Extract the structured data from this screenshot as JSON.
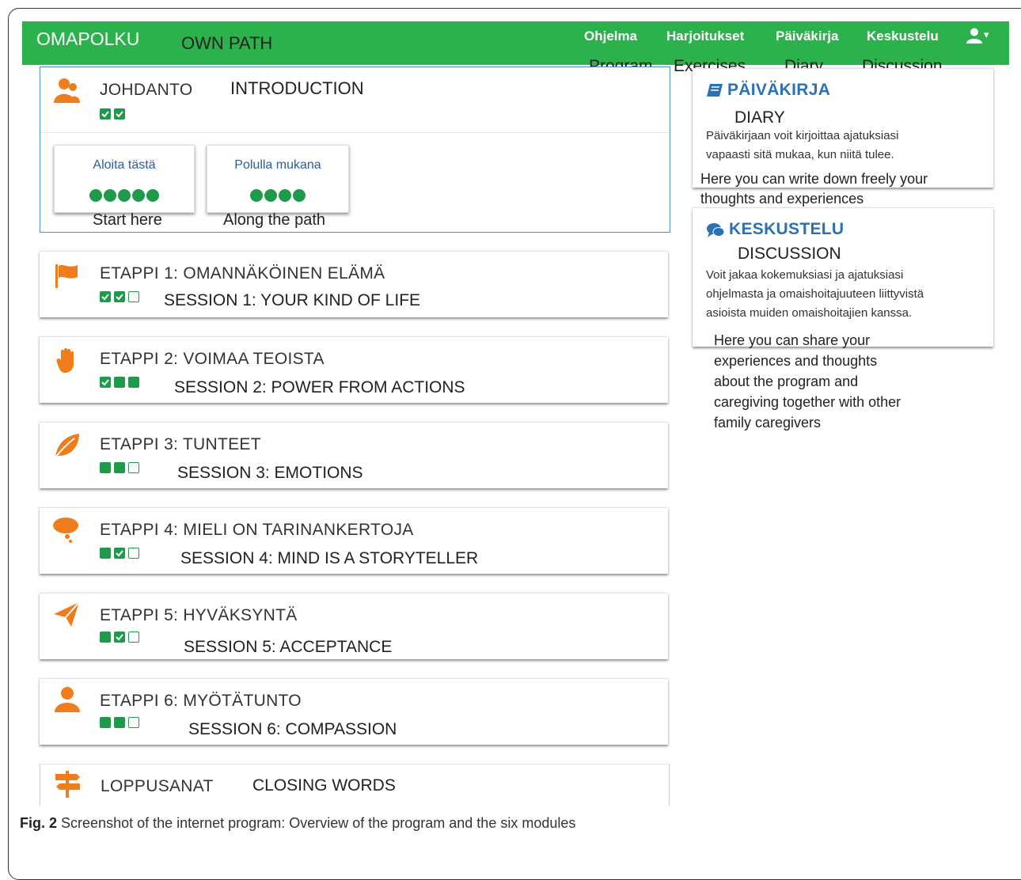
{
  "header": {
    "brand": "OMAPOLKU",
    "brand_translation": "OWN PATH",
    "nav": [
      {
        "label": "Ohjelma",
        "translation": "Program"
      },
      {
        "label": "Harjoitukset",
        "translation": "Exercises"
      },
      {
        "label": "Päiväkirja",
        "translation": "Diary"
      },
      {
        "label": "Keskustelu",
        "translation": "Discussion"
      }
    ],
    "user_menu_caret": "▾"
  },
  "intro": {
    "title": "JOHDANTO",
    "translation": "INTRODUCTION",
    "progress": [
      "check",
      "check"
    ],
    "subcards": [
      {
        "label": "Aloita tästä",
        "translation": "Start here",
        "dots": 5
      },
      {
        "label": "Polulla mukana",
        "translation": "Along the path",
        "dots": 4
      }
    ]
  },
  "modules": [
    {
      "title": "ETAPPI 1: OMANNÄKÖINEN ELÄMÄ",
      "translation": "SESSION 1: YOUR KIND OF LIFE",
      "icon": "flag-icon",
      "progress": [
        "check",
        "check",
        "empty"
      ]
    },
    {
      "title": "ETAPPI 2: VOIMAA TEOISTA",
      "translation": "SESSION 2: POWER FROM ACTIONS",
      "icon": "hand-icon",
      "progress": [
        "check",
        "full",
        "full"
      ]
    },
    {
      "title": "ETAPPI 3: TUNTEET",
      "translation": "SESSION 3: EMOTIONS",
      "icon": "leaf-icon",
      "progress": [
        "full",
        "full",
        "empty"
      ]
    },
    {
      "title": "ETAPPI 4: MIELI ON TARINANKERTOJA",
      "translation": "SESSION 4: MIND IS A STORYTELLER",
      "icon": "thought-cloud-icon",
      "progress": [
        "full",
        "check",
        "empty"
      ]
    },
    {
      "title": "ETAPPI 5: HYVÄKSYNTÄ",
      "translation": "SESSION 5: ACCEPTANCE",
      "icon": "paper-plane-icon",
      "progress": [
        "full",
        "check",
        "empty"
      ]
    },
    {
      "title": "ETAPPI 6: MYÖTÄTUNTO",
      "translation": "SESSION 6: COMPASSION",
      "icon": "person-icon",
      "progress": [
        "full",
        "full",
        "empty"
      ]
    }
  ],
  "closing": {
    "title": "LOPPUSANAT",
    "translation": "CLOSING WORDS",
    "icon": "signpost-icon"
  },
  "sidebar": {
    "diary": {
      "title": "PÄIVÄKIRJA",
      "translation": "DIARY",
      "text_lines": [
        "Päiväkirjaan voit kirjoittaa ajatuksiasi",
        "vapaasti sitä mukaa, kun niitä tulee."
      ],
      "translation_lines": [
        "Here you can write down freely your",
        "thoughts and experiences"
      ]
    },
    "discussion": {
      "title": "KESKUSTELU",
      "translation": "DISCUSSION",
      "text_lines": [
        "Voit jakaa kokemuksiasi ja ajatuksiasi",
        "ohjelmasta ja omaishoitajuuteen liittyvistä",
        "asioista muiden omaishoitajien kanssa."
      ],
      "translation_lines": [
        "Here you can share your",
        "experiences and thoughts",
        "about the program and",
        "caregiving together with other",
        "family caregivers"
      ]
    }
  },
  "caption": {
    "label": "Fig. 2",
    "text": "Screenshot of the internet program: Overview of the program and the six modules"
  },
  "colors": {
    "nav_green": "#2bb24c",
    "progress_green": "#1f9a4a",
    "icon_orange": "#f07d1b",
    "link_blue": "#2a72b5"
  }
}
